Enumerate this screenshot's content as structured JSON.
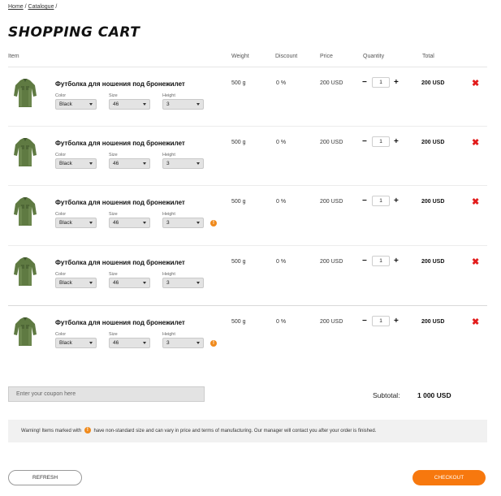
{
  "breadcrumb": {
    "home": "Home",
    "sep1": "/",
    "catalogue": "Catalogue",
    "sep2": "/"
  },
  "page_title": "SHOPPING CART",
  "columns": {
    "item": "Item",
    "weight": "Weight",
    "discount": "Discount",
    "price": "Price",
    "quantity": "Quantity",
    "total": "Total"
  },
  "option_labels": {
    "color": "Color",
    "size": "Size",
    "height": "Height"
  },
  "qty_controls": {
    "minus": "−",
    "plus": "+"
  },
  "remove_icon": "✖",
  "items": [
    {
      "name": "Футболка для ношения под бронежилет",
      "color": "Black",
      "size": "46",
      "height": "3",
      "weight": "500 g",
      "discount": "0 %",
      "price": "200 USD",
      "quantity": "1",
      "total": "200 USD",
      "warning": false
    },
    {
      "name": "Футболка для ношения под бронежилет",
      "color": "Black",
      "size": "46",
      "height": "3",
      "weight": "500 g",
      "discount": "0 %",
      "price": "200 USD",
      "quantity": "1",
      "total": "200 USD",
      "warning": false
    },
    {
      "name": "Футболка для ношения под бронежилет",
      "color": "Black",
      "size": "46",
      "height": "3",
      "weight": "500 g",
      "discount": "0 %",
      "price": "200 USD",
      "quantity": "1",
      "total": "200 USD",
      "warning": true
    },
    {
      "name": "Футболка для ношения под бронежилет",
      "color": "Black",
      "size": "46",
      "height": "3",
      "weight": "500 g",
      "discount": "0 %",
      "price": "200 USD",
      "quantity": "1",
      "total": "200 USD",
      "warning": false
    },
    {
      "name": "Футболка для ношения под бронежилет",
      "color": "Black",
      "size": "46",
      "height": "3",
      "weight": "500 g",
      "discount": "0 %",
      "price": "200 USD",
      "quantity": "1",
      "total": "200 USD",
      "warning": true
    }
  ],
  "warning_glyph": "!",
  "coupon": {
    "placeholder": "Enter your coupon here"
  },
  "subtotal": {
    "label": "Subtotal:",
    "value": "1 000 USD"
  },
  "warning_box": {
    "before": "Warning! Items marked with",
    "after": "have non-standard size and can vary in price and terms of manufacturing. Our manager will contact you after your order is finished."
  },
  "buttons": {
    "refresh": "REFRESH",
    "checkout": "CHECKOUT"
  },
  "colors": {
    "accent": "#f7780e",
    "remove": "#e21b1b",
    "warning": "#f08a1c"
  }
}
